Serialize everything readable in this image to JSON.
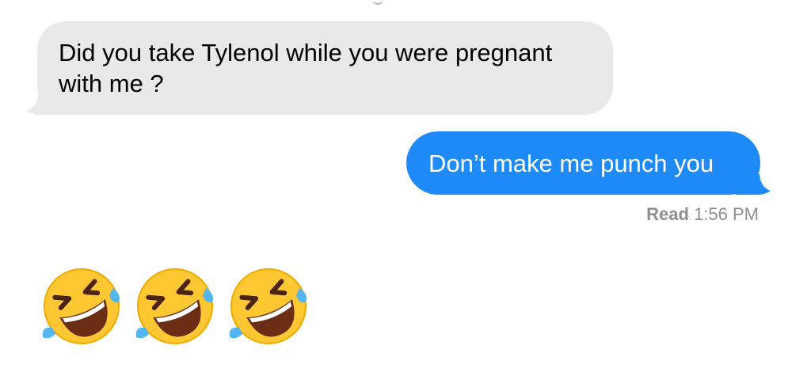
{
  "conversation": {
    "incoming_message": {
      "text": "Did you take Tylenol while you were pregnant with me ?"
    },
    "outgoing_message": {
      "text": "Don’t make me punch you"
    },
    "read_receipt": {
      "label": "Read",
      "time": "1:56 PM"
    },
    "emoji_message": {
      "emojis": [
        "rolling-on-floor-laughing",
        "rolling-on-floor-laughing",
        "rolling-on-floor-laughing"
      ]
    }
  },
  "colors": {
    "incoming_bubble": "#e9e9eb",
    "outgoing_bubble": "#1f8bfb",
    "receipt_text": "#8e8e93",
    "emoji_face": "#ffc832",
    "tear": "#54b5f0"
  }
}
